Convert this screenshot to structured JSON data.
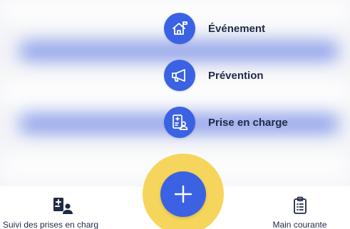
{
  "menu": {
    "items": [
      {
        "label": "Événement",
        "icon": "house-flag-icon"
      },
      {
        "label": "Prévention",
        "icon": "megaphone-icon"
      },
      {
        "label": "Prise en charge",
        "icon": "patient-file-icon"
      }
    ]
  },
  "fab": {
    "icon": "plus-icon"
  },
  "bottom_nav": {
    "left": {
      "label": "Suivi des prises en charg",
      "icon": "patient-tracking-icon"
    },
    "right": {
      "label": "Main courante",
      "icon": "clipboard-list-icon"
    }
  },
  "colors": {
    "accent": "#3b62e3",
    "fab_halo": "#f6d55c",
    "text": "#1f2a44"
  }
}
